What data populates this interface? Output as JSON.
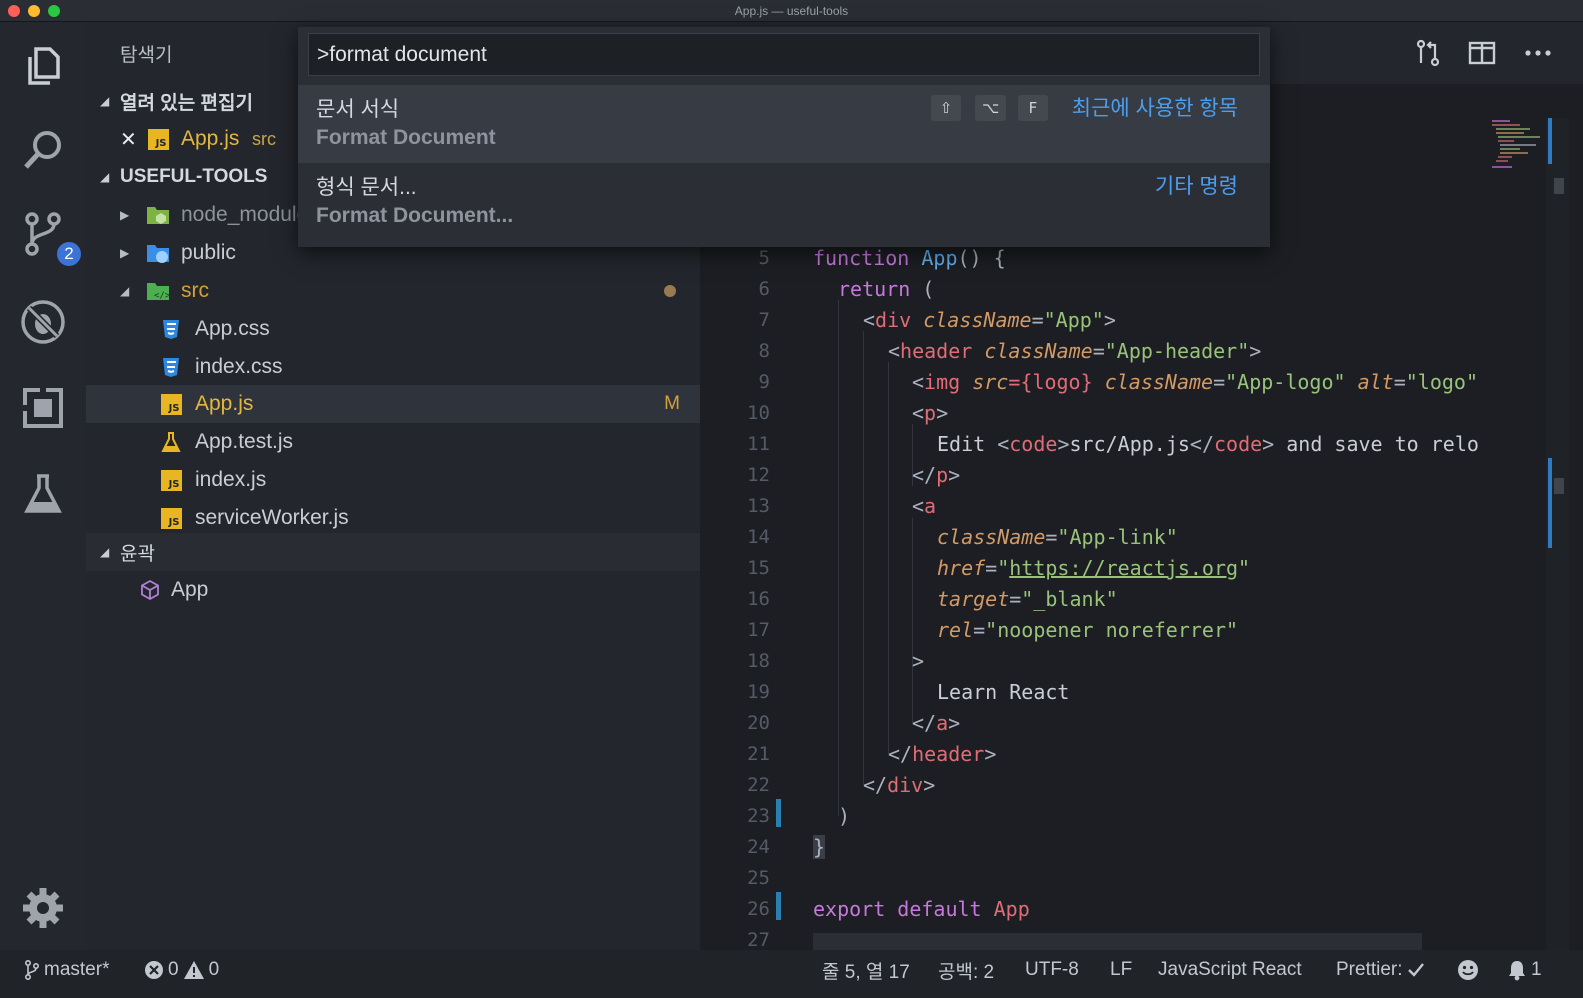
{
  "window": {
    "title": "App.js — useful-tools"
  },
  "sidebar": {
    "header": "탐색기",
    "open_editors": {
      "label": "열려 있는 편집기",
      "items": [
        {
          "name": "App.js",
          "hint": "src",
          "close_glyph": "✕"
        }
      ]
    },
    "project": {
      "label": "USEFUL-TOOLS",
      "items": [
        {
          "name": "node_modules",
          "kind": "folder",
          "expanded": false
        },
        {
          "name": "public",
          "kind": "folder",
          "expanded": false
        },
        {
          "name": "src",
          "kind": "folder",
          "expanded": true
        },
        {
          "name": "App.css",
          "kind": "css"
        },
        {
          "name": "index.css",
          "kind": "css"
        },
        {
          "name": "App.js",
          "kind": "js",
          "status": "M",
          "selected": true
        },
        {
          "name": "App.test.js",
          "kind": "test"
        },
        {
          "name": "index.js",
          "kind": "js"
        },
        {
          "name": "serviceWorker.js",
          "kind": "js"
        }
      ]
    },
    "outline": {
      "label": "윤곽",
      "items": [
        {
          "name": "App",
          "kind": "class"
        }
      ]
    }
  },
  "activity_bar": {
    "items": [
      "explorer-icon",
      "search-icon",
      "source-control-icon",
      "debug-icon",
      "extensions-icon",
      "test-icon"
    ],
    "source_control_badge": "2",
    "settings": "gear-icon"
  },
  "command_palette": {
    "input_value": ">format document",
    "items": [
      {
        "label": "문서 서식",
        "detail": "Format Document",
        "keys": [
          "⇧",
          "⌥",
          "F"
        ],
        "category": "최근에 사용한 항목",
        "active": true
      },
      {
        "label": "형식 문서...",
        "detail": "Format Document...",
        "keys": [],
        "category": "기타 명령",
        "active": false
      }
    ]
  },
  "editor": {
    "line_numbers": [
      "5",
      "6",
      "7",
      "8",
      "9",
      "10",
      "11",
      "12",
      "13",
      "14",
      "15",
      "16",
      "17",
      "18",
      "19",
      "20",
      "21",
      "22",
      "23",
      "24",
      "25",
      "26",
      "27"
    ],
    "code": {
      "l5": {
        "kw": "function",
        "fn": "App",
        "rest": "() {"
      },
      "l6": {
        "kw": "return",
        "rest": " ("
      },
      "l7": {
        "o": "<",
        "tag": "div",
        "attr": "className",
        "eq": "=",
        "str": "\"App\"",
        "c": ">"
      },
      "l8": {
        "o": "<",
        "tag": "header",
        "attr": "className",
        "eq": "=",
        "str": "\"App-header\"",
        "c": ">"
      },
      "l9": {
        "o": "<",
        "tag": "img",
        "a1": "src",
        "e1": "={",
        "v1": "logo",
        "e1c": "}",
        "a2": "className",
        "e2": "=",
        "s2": "\"App-logo\"",
        "a3": "alt",
        "e3": "=",
        "s3": "\"logo\""
      },
      "l10": {
        "o": "<",
        "tag": "p",
        "c": ">"
      },
      "l11": {
        "t1": "Edit ",
        "o1": "<",
        "tag1": "code",
        "c1": ">",
        "t2": "src/App.js",
        "o2": "</",
        "tag2": "code",
        "c2": ">",
        "t3": " and save to relo"
      },
      "l12": {
        "o": "</",
        "tag": "p",
        "c": ">"
      },
      "l13": {
        "o": "<",
        "tag": "a"
      },
      "l14": {
        "attr": "className",
        "eq": "=",
        "str": "\"App-link\""
      },
      "l15": {
        "attr": "href",
        "eq": "=",
        "q1": "\"",
        "url": "https://reactjs.org",
        "q2": "\""
      },
      "l16": {
        "attr": "target",
        "eq": "=",
        "str": "\"_blank\""
      },
      "l17": {
        "attr": "rel",
        "eq": "=",
        "str": "\"noopener noreferrer\""
      },
      "l18": {
        "t": ">"
      },
      "l19": {
        "t": "Learn React"
      },
      "l20": {
        "o": "</",
        "tag": "a",
        "c": ">"
      },
      "l21": {
        "o": "</",
        "tag": "header",
        "c": ">"
      },
      "l22": {
        "o": "</",
        "tag": "div",
        "c": ">"
      },
      "l23": {
        "t": ")"
      },
      "l24": {
        "t": "}"
      },
      "l26": {
        "k1": "export",
        "k2": "default",
        "id": "App"
      }
    }
  },
  "statusbar": {
    "branch": "master*",
    "errors": "0",
    "warnings": "0",
    "position": "줄 5, 열 17",
    "spaces": "공백: 2",
    "encoding": "UTF-8",
    "eol": "LF",
    "language": "JavaScript React",
    "formatter": "Prettier:",
    "notifications": "1"
  },
  "colors": {
    "accent": "#3b73d6",
    "link": "#4b9ff0",
    "js_icon": "#e8b623",
    "modified_bar": "#2a7fb0"
  }
}
